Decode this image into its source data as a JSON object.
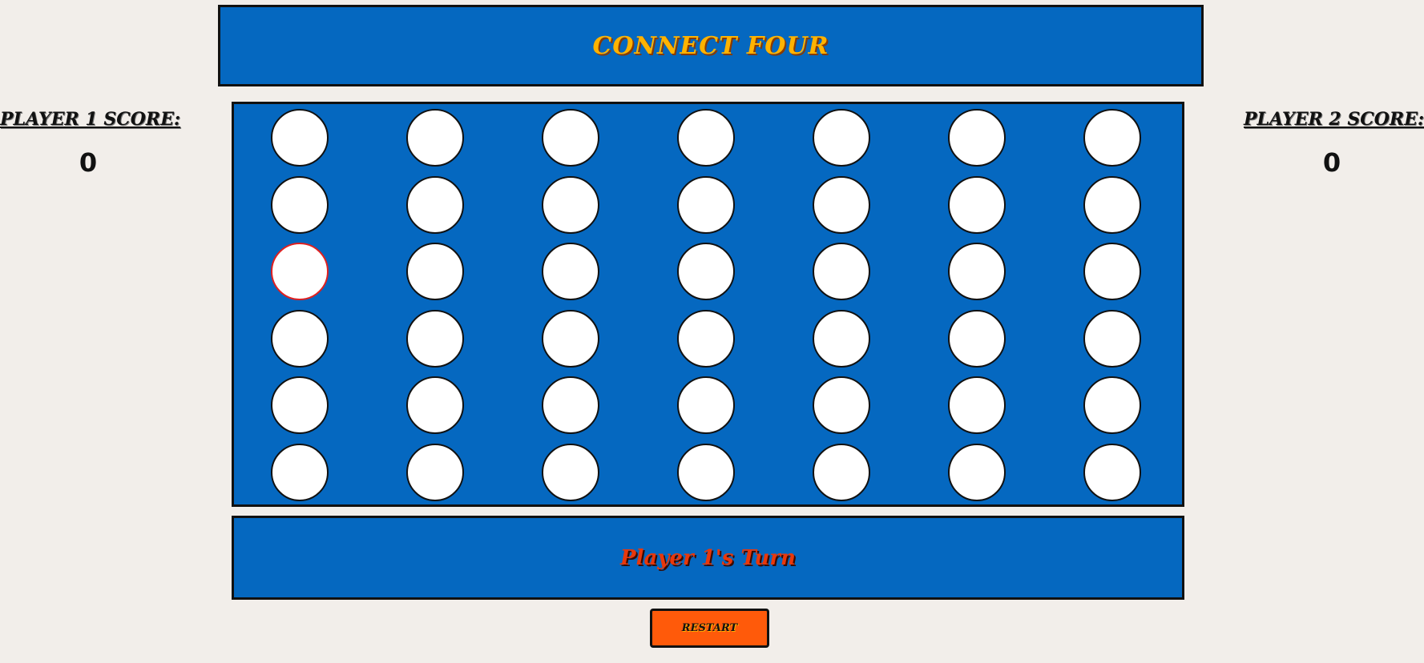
{
  "header": {
    "title": "CONNECT FOUR"
  },
  "players": [
    {
      "score_label": "PLAYER 1 SCORE:",
      "score": "0"
    },
    {
      "score_label": "PLAYER 2 SCORE:",
      "score": "0"
    }
  ],
  "board": {
    "rows": 6,
    "columns": 7,
    "highlighted_cell": {
      "row": 2,
      "column": 0
    },
    "cells": [
      [
        "empty",
        "empty",
        "empty",
        "empty",
        "empty",
        "empty",
        "empty"
      ],
      [
        "empty",
        "empty",
        "empty",
        "empty",
        "empty",
        "empty",
        "empty"
      ],
      [
        "empty",
        "empty",
        "empty",
        "empty",
        "empty",
        "empty",
        "empty"
      ],
      [
        "empty",
        "empty",
        "empty",
        "empty",
        "empty",
        "empty",
        "empty"
      ],
      [
        "empty",
        "empty",
        "empty",
        "empty",
        "empty",
        "empty",
        "empty"
      ],
      [
        "empty",
        "empty",
        "empty",
        "empty",
        "empty",
        "empty",
        "empty"
      ]
    ]
  },
  "status": {
    "text": "Player 1's Turn"
  },
  "controls": {
    "restart_label": "RESTART"
  },
  "colors": {
    "board_blue": "#0568c0",
    "title_yellow": "#ffb300",
    "status_red": "#e8380c",
    "restart_orange": "#ff5a0a",
    "highlight_red": "#e02020",
    "background": "#f2eeea"
  }
}
